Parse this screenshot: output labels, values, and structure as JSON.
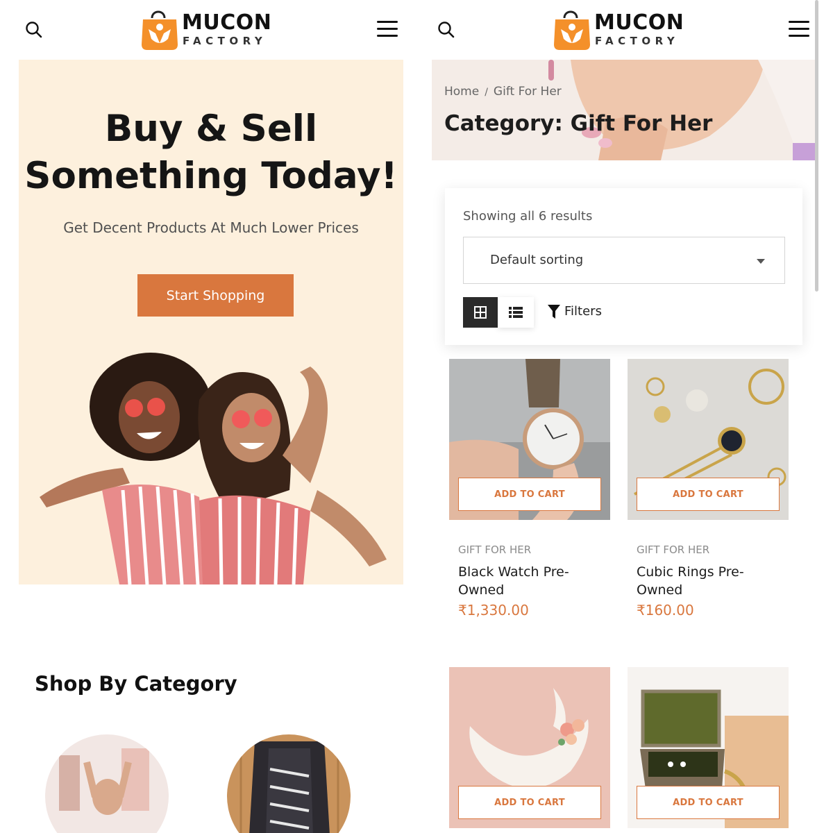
{
  "colors": {
    "accent": "#d9773e",
    "hero_bg": "#fdf0dd",
    "logo_orange": "#f4902a"
  },
  "brand": {
    "name": "MUCON",
    "tagline": "FACTORY"
  },
  "left": {
    "hero": {
      "title_line1": "Buy & Sell",
      "title_line2": "Something Today!",
      "subtitle": "Get Decent Products At Much Lower Prices",
      "cta": "Start Shopping"
    },
    "section_title": "Shop By Category",
    "categories": [
      {
        "icon": "clothing-photo"
      },
      {
        "icon": "sneaker-photo"
      }
    ]
  },
  "right": {
    "breadcrumb": {
      "home": "Home",
      "sep": "/",
      "current": "Gift For Her"
    },
    "page_title": "Category: Gift For Her",
    "result_count": "Showing all 6 results",
    "sorting": "Default sorting",
    "filters_label": "Filters",
    "products": [
      {
        "category": "GIFT FOR HER",
        "name": "Black Watch Pre-Owned",
        "price": "₹1,330.00",
        "button": "ADD TO CART"
      },
      {
        "category": "GIFT FOR HER",
        "name": "Cubic Rings Pre-Owned",
        "price": "₹160.00",
        "button": "ADD TO CART"
      },
      {
        "button": "ADD TO CART"
      },
      {
        "button": "ADD TO CART"
      }
    ]
  }
}
